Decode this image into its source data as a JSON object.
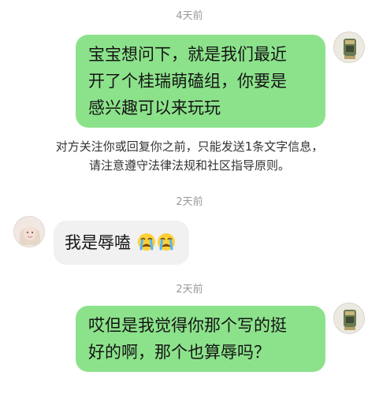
{
  "chat": {
    "messages": [
      {
        "timestamp": "4天前",
        "sender": "self",
        "text_lines": [
          "宝宝想问下，就是我们最近",
          "开了个桂瑞萌磕组，你要是",
          "感兴趣可以来玩玩"
        ]
      },
      {
        "sender": "system",
        "text_lines": [
          "对方关注你或回复你之前，只能发送1条文字信息，",
          "请注意遵守法律法规和社区指导原则。"
        ]
      },
      {
        "timestamp": "2天前",
        "sender": "other",
        "text": "我是辱嗑",
        "emojis": [
          "crying-face",
          "crying-face"
        ]
      },
      {
        "timestamp": "2天前",
        "sender": "self",
        "text_lines": [
          "哎但是我觉得你那个写的挺",
          "好的啊，那个也算辱吗？"
        ]
      }
    ]
  },
  "colors": {
    "outgoing_bubble": "#8ce28b",
    "incoming_bubble": "#f1f1f1",
    "timestamp": "#9a9a9a"
  },
  "icons": {
    "self_avatar": "self-avatar",
    "other_avatar": "other-avatar",
    "emoji": "crying-face-icon"
  }
}
